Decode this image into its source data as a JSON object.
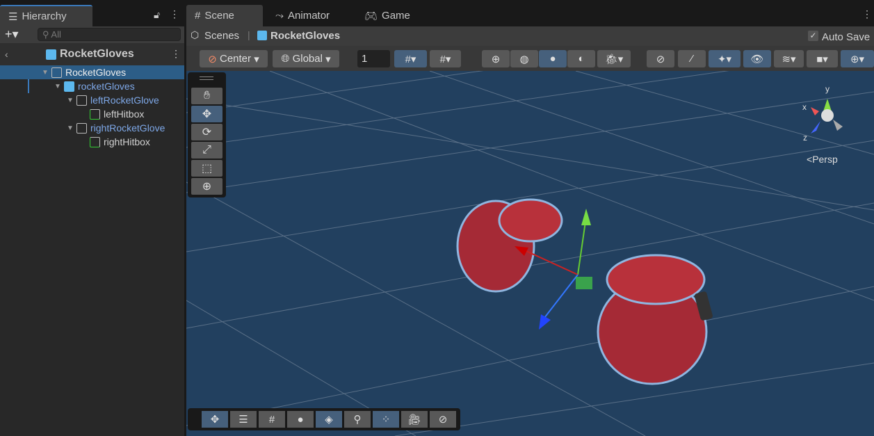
{
  "tabs": {
    "hierarchy": "Hierarchy",
    "scene": "Scene",
    "animator": "Animator",
    "game": "Game"
  },
  "hierarchy": {
    "search_placeholder": "All",
    "breadcrumb": "RocketGloves",
    "rows": [
      {
        "label": "RocketGloves",
        "selected": true
      },
      {
        "label": "rocketGloves"
      },
      {
        "label": "leftRocketGlove"
      },
      {
        "label": "leftHitbox"
      },
      {
        "label": "rightRocketGlove"
      },
      {
        "label": "rightHitbox"
      }
    ]
  },
  "scene": {
    "breadcrumb_root": "Scenes",
    "breadcrumb_current": "RocketGloves",
    "auto_save": "Auto Save",
    "auto_save_checked": true,
    "pivot": "Center",
    "space": "Global",
    "grid_increment": "1",
    "camera_mode": "Persp",
    "gizmo_axes": {
      "x": "x",
      "y": "y",
      "z": "z"
    }
  },
  "colors": {
    "selected": "#2c5d87",
    "accent": "#46607c",
    "viewport": "#22405f",
    "prefab_blue": "#7ea8e8"
  }
}
